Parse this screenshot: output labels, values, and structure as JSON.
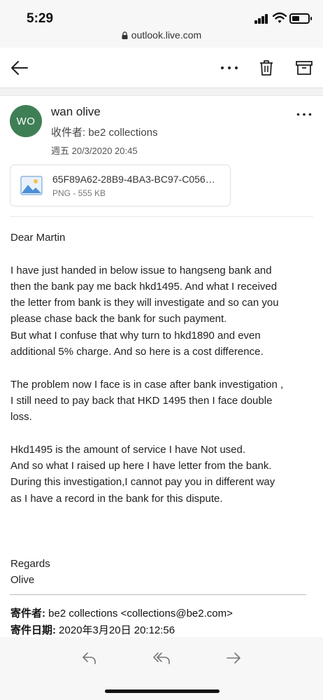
{
  "status_bar": {
    "time": "5:29",
    "url": "outlook.live.com"
  },
  "toolbar": {
    "icons": [
      "back-arrow-icon",
      "more-icon",
      "trash-icon",
      "archive-icon"
    ]
  },
  "message": {
    "avatar_initials": "WO",
    "avatar_color": "#3f7f55",
    "sender": "wan olive",
    "to": "收件者: be2 collections",
    "date": "週五 20/3/2020 20:45",
    "attachment": {
      "name": "65F89A62-28B9-4BA3-BC97-C056…",
      "meta": "PNG - 555 KB",
      "icon": "image-file-icon"
    },
    "body": [
      "Dear Martin",
      "I have just handed in below issue to hangseng bank and",
      "then the bank pay me back hkd1495. And what I received",
      "the letter from bank is they will investigate and so can you",
      "please chase back the bank for such payment.",
      "But what I confuse that why turn to hkd1890 and even",
      "additional 5% charge.  And so here is a cost difference.",
      "The problem now I face is in case after bank investigation ,",
      "I still need to pay back that HKD 1495 then I face double",
      "loss.",
      "Hkd1495 is the amount of service I have Not used.",
      "And so what I raised up here I have letter from the bank.",
      "During this investigation,I cannot pay you in different way",
      "as I have a record in the bank for this dispute.",
      "Regards",
      "Olive"
    ],
    "quoted": {
      "from_label": "寄件者:",
      "from_value": " be2 collections <collections@be2.com>",
      "date_label": "寄件日期:",
      "date_value": " 2020年3月20日 20:12:56"
    }
  },
  "bottom_bar": {
    "icons": [
      "reply-icon",
      "reply-all-icon",
      "forward-icon"
    ]
  }
}
